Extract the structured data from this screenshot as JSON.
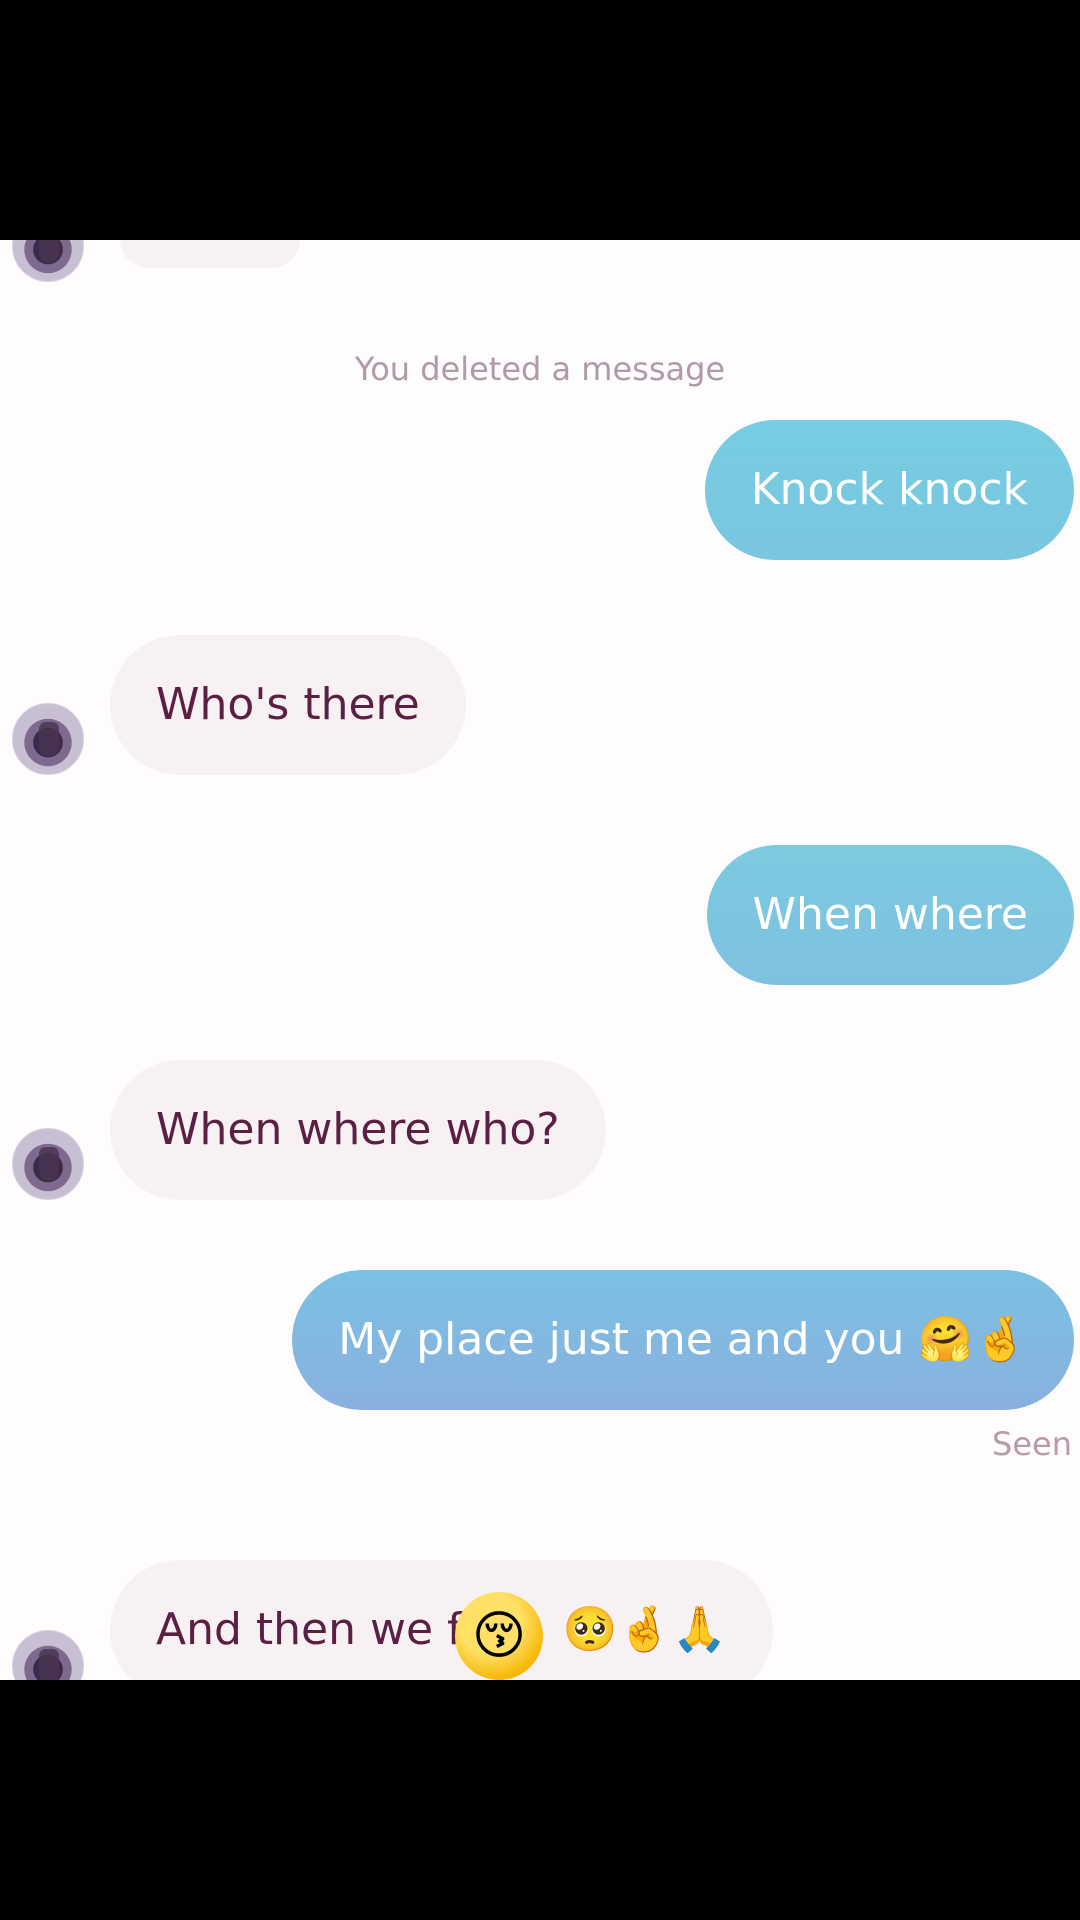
{
  "system": {
    "deleted_notice": "You deleted a message",
    "seen_label": "Seen"
  },
  "messages": [
    {
      "id": "m1",
      "direction": "out",
      "text": "Knock knock"
    },
    {
      "id": "m2",
      "direction": "in",
      "text": "Who's there"
    },
    {
      "id": "m3",
      "direction": "out",
      "text": "When where"
    },
    {
      "id": "m4",
      "direction": "in",
      "text": "When where who?"
    },
    {
      "id": "m5",
      "direction": "out",
      "text": "My place just me and you",
      "emojis": "🤗🤞"
    },
    {
      "id": "m6",
      "direction": "in",
      "text": "And then we f",
      "emojis": "🥺🤞🙏"
    }
  ],
  "overlay": {
    "reaction_emoji": "😚"
  },
  "icons": {
    "avatar": "avatar-icon"
  },
  "colors": {
    "incoming_bg": "#f7f1f4",
    "incoming_text": "#5b1f42",
    "outgoing_gradient_top": "#7acbe0",
    "outgoing_gradient_bottom": "#8ab0df",
    "meta_text": "#b09aaa"
  }
}
